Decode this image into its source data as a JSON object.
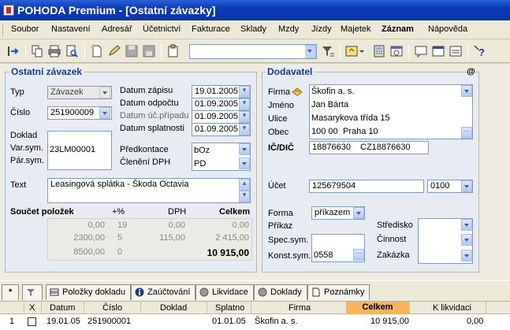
{
  "window": {
    "title": "POHODA Premium - [Ostatní závazky]"
  },
  "menu": [
    {
      "label": "Soubor",
      "bold": false
    },
    {
      "label": "Nastavení",
      "bold": false
    },
    {
      "label": "Adresář",
      "bold": false
    },
    {
      "label": "Účetnictví",
      "bold": false
    },
    {
      "label": "Fakturace",
      "bold": false
    },
    {
      "label": "Sklady",
      "bold": false
    },
    {
      "label": "Mzdy",
      "bold": false
    },
    {
      "label": "Jízdy",
      "bold": false
    },
    {
      "label": "Majetek",
      "bold": false
    },
    {
      "label": "Záznam",
      "bold": true
    },
    {
      "label": "Nápověda",
      "bold": false
    }
  ],
  "toolbar": {
    "combo_value": ""
  },
  "left": {
    "title": "Ostatní závazek",
    "typ_label": "Typ",
    "typ_value": "Závazek",
    "cislo_label": "Číslo",
    "cislo_value": "251900009",
    "doklad_label": "Doklad",
    "varsym_label": "Var.sym.",
    "varsym_value": "23LM00001",
    "parsym_label": "Pár.sym.",
    "parsym_value": "",
    "datum_zapisu_label": "Datum zápisu",
    "datum_zapisu_value": "19.01.2005",
    "datum_odpoctu_label": "Datum odpočtu",
    "datum_odpoctu_value": "01.09.2005",
    "datum_uc_label": "Datum úč.případu",
    "datum_uc_value": "01.09.2005",
    "datum_splatnosti_label": "Datum splatnosti",
    "datum_splatnosti_value": "01.09.2005",
    "predkontace_label": "Předkontace",
    "predkontace_value": "bOz",
    "cleneni_label": "Členění DPH",
    "cleneni_value": "PD",
    "text_label": "Text",
    "text_value": "Leasingová splátka - Škoda Octavia",
    "sum_title": "Součet položek",
    "sum_pct_header": "+%",
    "sum_dph_header": "DPH",
    "sum_celkem_header": "Celkem",
    "sum_rows": [
      {
        "base": "0,00",
        "pct": "19",
        "dph": "0,00",
        "total": "0,00"
      },
      {
        "base": "2300,00",
        "pct": "5",
        "dph": "115,00",
        "total": "2 415,00"
      },
      {
        "base": "8500,00",
        "pct": "0",
        "dph": "",
        "total": ""
      }
    ],
    "sum_total": "10 915,00"
  },
  "right": {
    "title": "Dodavatel",
    "at_symbol": "@",
    "firma_label": "Firma",
    "firma_value": "Škofin a. s.",
    "jmeno_label": "Jméno",
    "jmeno_value": "Jan Bárta",
    "ulice_label": "Ulice",
    "ulice_value": "Masarykova třída 15",
    "obec_label": "Obec",
    "psc_value": "100 00",
    "obec_value": "Praha 10",
    "icdic_label": "IČ/DIČ",
    "ic_value": "18876630",
    "dic_value": "CZ18876630",
    "ucet_label": "Účet",
    "ucet_value": "125679504",
    "banka_value": "0100",
    "forma_label": "Forma",
    "forma_value": "příkazem",
    "prikaz_label": "Příkaz",
    "specsym_label": "Spec.sym.",
    "konstsym_label": "Konst.sym.",
    "konstsym_value": "0558",
    "stredisko_label": "Středisko",
    "cinnost_label": "Činnost",
    "zakazka_label": "Zakázka"
  },
  "tabs": [
    {
      "label": "*"
    },
    {
      "label": ""
    },
    {
      "label": "Položky dokladu"
    },
    {
      "label": "Zaúčtování"
    },
    {
      "label": "Likvidace"
    },
    {
      "label": "Doklady"
    },
    {
      "label": "Poznámky"
    }
  ],
  "grid": {
    "headers": [
      "X",
      "Datum",
      "Číslo",
      "Doklad",
      "Splatno",
      "Firma",
      "Celkem",
      "K likvidaci"
    ],
    "rows": [
      {
        "num": "1",
        "datum": "19.01.05",
        "cislo": "251900001",
        "doklad": "",
        "splatno": "01.01.05",
        "firma": "Škofin a. s.",
        "celkem": "10 915,00",
        "k_likvidaci": "0,00"
      }
    ]
  }
}
